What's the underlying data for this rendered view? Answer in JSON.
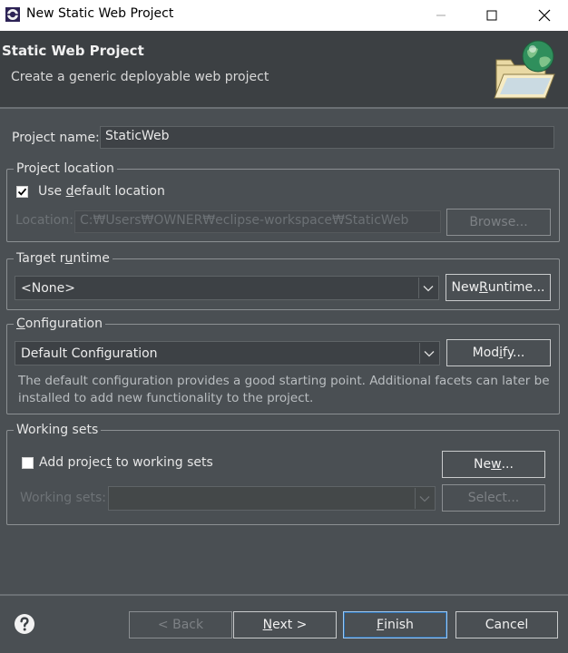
{
  "window": {
    "title": "New Static Web Project",
    "minimize_icon": "minimize-icon",
    "maximize_icon": "maximize-icon",
    "close_icon": "close-icon"
  },
  "banner": {
    "title": "Static Web Project",
    "subtitle": "Create a generic deployable web project",
    "icon": "folder-globe-icon"
  },
  "project_name": {
    "label": "Project name:",
    "value": "StaticWeb"
  },
  "project_location": {
    "legend": "Project location",
    "use_default": {
      "pre": "Use ",
      "mnemonic": "d",
      "post": "efault location",
      "checked": true
    },
    "location_label": "Location:",
    "location_value": "C:₩Users₩OWNER₩eclipse-workspace₩StaticWeb",
    "browse_label": "Browse..."
  },
  "target_runtime": {
    "legend_pre": "Target r",
    "legend_mnemonic": "u",
    "legend_post": "ntime",
    "selected": "<None>",
    "new_runtime_pre": "New ",
    "new_runtime_mnemonic": "R",
    "new_runtime_post": "untime..."
  },
  "configuration": {
    "legend_mnemonic": "C",
    "legend_post": "onfiguration",
    "selected": "Default Configuration",
    "modify_pre": "Mod",
    "modify_mnemonic": "i",
    "modify_post": "fy...",
    "description_line1": "The default configuration provides a good starting point. Additional facets can later be",
    "description_line2": "installed to add new functionality to the project."
  },
  "working_sets": {
    "legend": "Working sets",
    "add_pre": "Add projec",
    "add_mnemonic": "t",
    "add_post": " to working sets",
    "add_checked": false,
    "new_pre": "Ne",
    "new_mnemonic": "w",
    "new_post": "...",
    "working_sets_label": "Working sets:",
    "select_label": "Select..."
  },
  "footer": {
    "help_icon": "help-icon",
    "back_label": "< Back",
    "next_mnemonic": "N",
    "next_post": "ext >",
    "finish_mnemonic": "F",
    "finish_post": "inish",
    "cancel_label": "Cancel"
  }
}
